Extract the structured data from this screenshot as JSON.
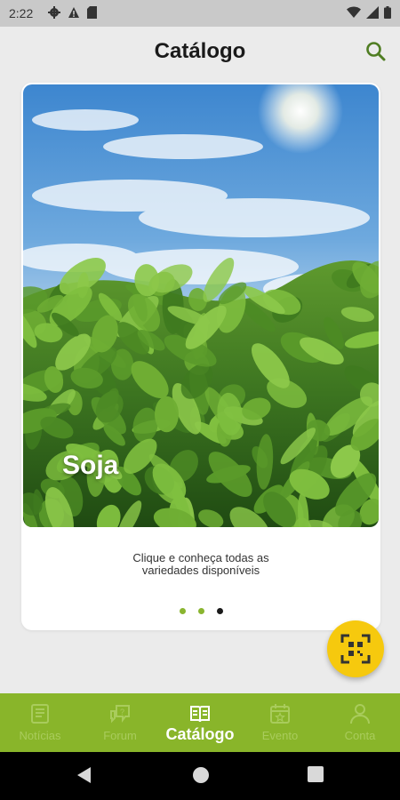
{
  "status_bar": {
    "time": "2:22"
  },
  "header": {
    "title": "Catálogo"
  },
  "card": {
    "title": "Soja",
    "description_line1": "Clique e conheça todas as",
    "description_line2": "variedades disponíveis",
    "pager": {
      "count": 3,
      "active_index": 2
    }
  },
  "nav": {
    "items": [
      {
        "label": "Notícias",
        "icon": "newspaper-icon"
      },
      {
        "label": "Forum",
        "icon": "chat-question-icon"
      },
      {
        "label": "Catálogo",
        "icon": "book-icon",
        "active": true
      },
      {
        "label": "Evento",
        "icon": "calendar-star-icon"
      },
      {
        "label": "Conta",
        "icon": "person-icon"
      }
    ]
  },
  "colors": {
    "brand_green": "#89b52a",
    "inactive_nav": "#a9cc5c",
    "fab_yellow": "#f6c90e",
    "pager_green": "#8ab530"
  }
}
